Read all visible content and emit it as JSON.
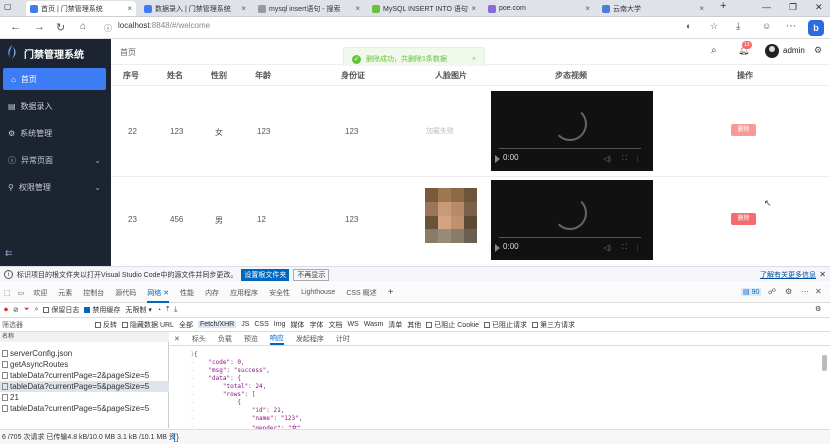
{
  "browser": {
    "tabs": [
      {
        "title": "首页 | 门禁管理系统",
        "active": true,
        "fav_color": "#3d7cf5"
      },
      {
        "title": "数据录入 | 门禁管理系统",
        "active": false,
        "fav_color": "#3d7cf5"
      },
      {
        "title": "mysql insert语句 - 搜索",
        "active": false,
        "fav_color": "#999999"
      },
      {
        "title": "MySQL INSERT INTO 语句",
        "active": false,
        "fav_color": "#6fbf3c"
      },
      {
        "title": "poe.com",
        "active": false,
        "fav_color": "#8a6bd6"
      },
      {
        "title": "云南大学",
        "active": false,
        "fav_color": "#4a7fd8"
      }
    ],
    "new_tab": "+",
    "window_controls": [
      "—",
      "❐",
      "✕"
    ],
    "url_host": "localhost",
    "url_rest": ":8848/#/welcome"
  },
  "app": {
    "title": "门禁管理系统",
    "menu": [
      {
        "label": "首页",
        "icon": "home-icon",
        "active": true,
        "chevron": false
      },
      {
        "label": "数据录入",
        "icon": "data-entry-icon",
        "active": false,
        "chevron": false
      },
      {
        "label": "系统管理",
        "icon": "settings-icon",
        "active": false,
        "chevron": false
      },
      {
        "label": "异常页面",
        "icon": "error-page-icon",
        "active": false,
        "chevron": true
      },
      {
        "label": "权限管理",
        "icon": "permission-icon",
        "active": false,
        "chevron": true
      }
    ],
    "breadcrumb": "首页",
    "user": "admin",
    "badge": "13"
  },
  "toast": {
    "message": "删除成功，共删除1条数据"
  },
  "table": {
    "headers": [
      "序号",
      "姓名",
      "性别",
      "年龄",
      "身份证",
      "人脸图片",
      "步态视频",
      "操作"
    ],
    "rows": [
      {
        "id": "22",
        "name": "123",
        "gender": "女",
        "age": "123",
        "idcard": "123",
        "image": "加载失败",
        "video_time": "0:00",
        "action": "删除"
      },
      {
        "id": "23",
        "name": "456",
        "gender": "男",
        "age": "12",
        "idcard": "123",
        "image": "",
        "video_time": "0:00",
        "action": "删除"
      }
    ]
  },
  "notification": {
    "text": "标识项目的根文件夹以打开Visual Studio Code中的源文件并同步更改。",
    "primary": "设置根文件夹",
    "secondary": "不再显示",
    "more": "了解有关更多信息"
  },
  "devtools": {
    "tabs": [
      "欢迎",
      "元素",
      "控制台",
      "源代码",
      "网络",
      "性能",
      "内存",
      "应用程序",
      "安全性",
      "Lighthouse",
      "CSS 概述"
    ],
    "active_tab": "网络",
    "issue_count": "90",
    "netbar": {
      "preserve_log": "保留日志",
      "disable_cache": "禁用缓存",
      "throttle": "无限制"
    },
    "filter": {
      "placeholder": "筛选器",
      "invert": "反转",
      "hide_data_urls": "隐藏数据 URL",
      "types": [
        "全部",
        "Fetch/XHR",
        "JS",
        "CSS",
        "Img",
        "媒体",
        "字体",
        "文档",
        "WS",
        "Wasm",
        "清单",
        "其他"
      ],
      "selected_type": "Fetch/XHR",
      "blocked_cookies": "已阻止 Cookie",
      "blocked_requests": "已阻止请求",
      "third_party": "第三方请求"
    },
    "request_header": "名称",
    "requests": [
      {
        "name": "serverConfig.json",
        "selected": false
      },
      {
        "name": "getAsyncRoutes",
        "selected": false
      },
      {
        "name": "tableData?currentPage=2&pageSize=5",
        "selected": false
      },
      {
        "name": "tableData?currentPage=5&pageSize=5",
        "selected": true
      },
      {
        "name": "21",
        "selected": false
      },
      {
        "name": "tableData?currentPage=5&pageSize=5",
        "selected": false
      }
    ],
    "detail_tabs": [
      "标头",
      "负载",
      "预览",
      "响应",
      "发起程序",
      "计时"
    ],
    "active_detail": "响应",
    "code_lines": [
      "{",
      "    \"code\": 0,",
      "    \"msg\": \"success\",",
      "    \"data\": {",
      "        \"total\": 24,",
      "        \"rows\": [",
      "            {",
      "                \"id\": 21,",
      "                \"name\": \"123\",",
      "                \"gender\": \"女\","
    ],
    "line_numbers": [
      "1",
      "-",
      "-",
      "-",
      "-",
      "-",
      "-",
      "-",
      "-",
      "-"
    ],
    "status": "6 /705 次请求  已传输4.8 kB/10.0 MB  3.1 kB /10.1 MB 资"
  }
}
